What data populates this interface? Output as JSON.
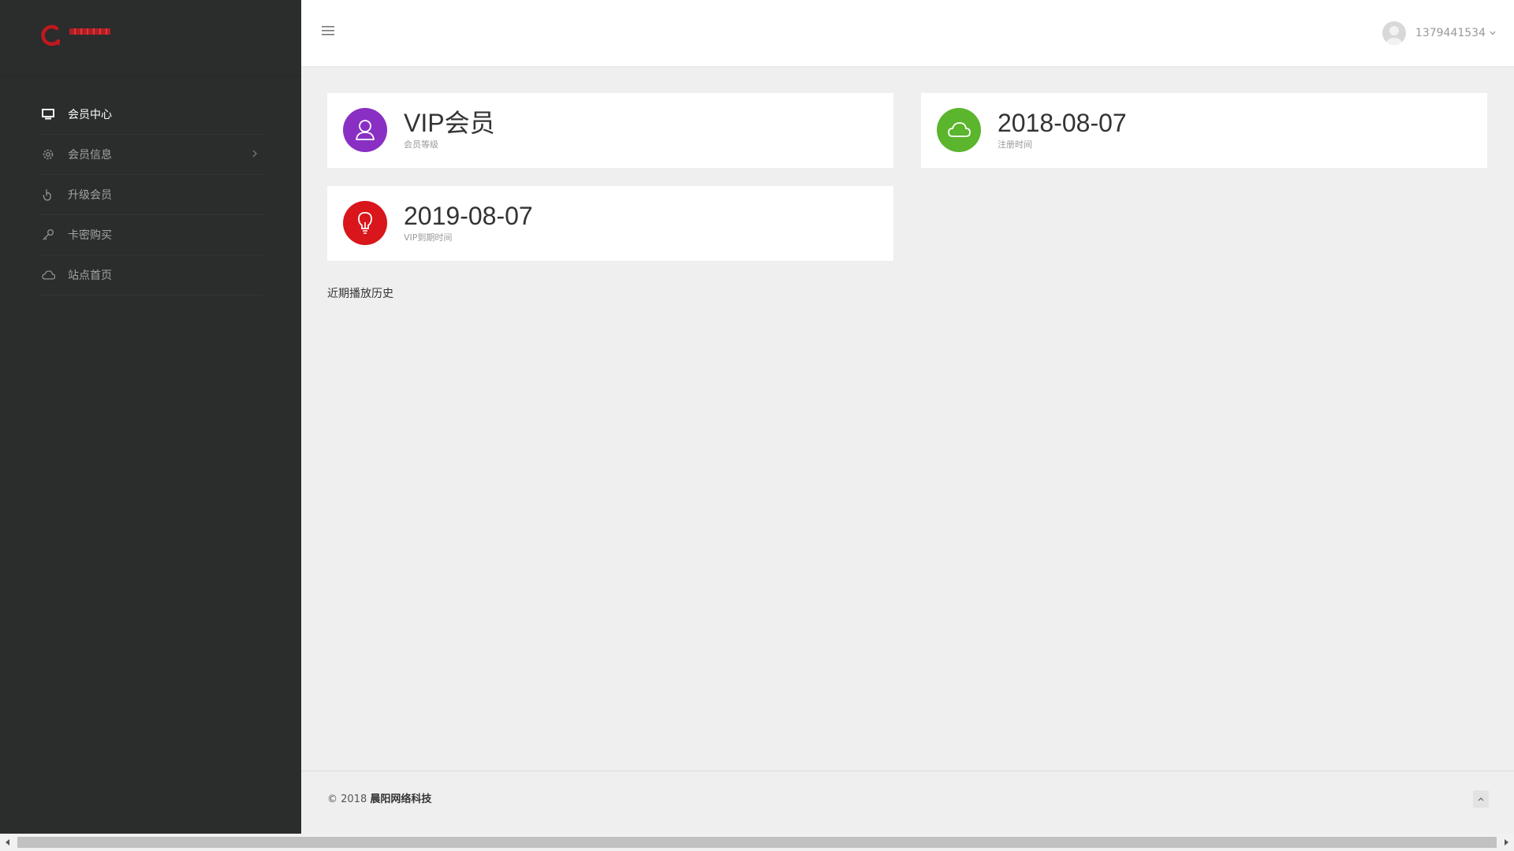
{
  "brand": {
    "accent": "#b01e22"
  },
  "sidebar": {
    "items": [
      {
        "label": "会员中心",
        "icon": "monitor-icon",
        "active": true
      },
      {
        "label": "会员信息",
        "icon": "gear-icon",
        "has_submenu": true
      },
      {
        "label": "升级会员",
        "icon": "hand-icon"
      },
      {
        "label": "卡密购买",
        "icon": "key-icon"
      },
      {
        "label": "站点首页",
        "icon": "cloud-icon"
      }
    ]
  },
  "header": {
    "menu_icon": "hamburger-icon",
    "username": "1379441534"
  },
  "cards": [
    {
      "value": "VIP会员",
      "label": "会员等级",
      "icon": "user-icon",
      "color": "#8a2fc4"
    },
    {
      "value": "2018-08-07",
      "label": "注册时间",
      "icon": "cloud-icon",
      "color": "#5bb52d"
    },
    {
      "value": "2019-08-07",
      "label": "VIP到期时间",
      "icon": "bulb-icon",
      "color": "#d9161b"
    }
  ],
  "history": {
    "title": "近期播放历史"
  },
  "footer": {
    "copyright": "© 2018",
    "company": "晨阳网络科技"
  }
}
